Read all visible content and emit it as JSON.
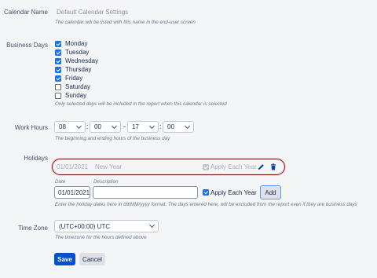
{
  "calendar_name": {
    "label": "Calendar Name",
    "value": "Default Calendar Settings",
    "help": "The calendar will be listed with this name in the end-user screen"
  },
  "business_days": {
    "label": "Business Days",
    "days": [
      {
        "name": "Monday",
        "checked": true
      },
      {
        "name": "Tuesday",
        "checked": true
      },
      {
        "name": "Wednesday",
        "checked": true
      },
      {
        "name": "Thursday",
        "checked": true
      },
      {
        "name": "Friday",
        "checked": true
      },
      {
        "name": "Saturday",
        "checked": false
      },
      {
        "name": "Sunday",
        "checked": false
      }
    ],
    "help": "Only selected days will be included in the report when this calendar is selected"
  },
  "work_hours": {
    "label": "Work Hours",
    "start_hour": "08",
    "start_min": "00",
    "end_hour": "17",
    "end_min": "00",
    "colon": ":",
    "dash": "-",
    "help": "The beginning and ending hours of the business day"
  },
  "holidays": {
    "label": "Holidays",
    "existing": {
      "date": "01/01/2021",
      "description": "New Year",
      "apply_each_year_label": "Apply Each Year",
      "apply_each_year": true
    },
    "new": {
      "date_label": "Date",
      "description_label": "Description",
      "date_value": "01/01/2021",
      "description_value": "",
      "apply_each_year_label": "Apply Each Year",
      "apply_each_year": true,
      "add_label": "Add"
    },
    "help": "Enter the holiday dates here in dd/MM/yyyy format. The days entered here, will be excluded from the report even if they are business days"
  },
  "time_zone": {
    "label": "Time Zone",
    "value": "(UTC+00:00) UTC",
    "help": "The timezone for the hours defined above"
  },
  "actions": {
    "save_label": "Save",
    "cancel_label": "Cancel"
  },
  "colors": {
    "primary": "#0052cc",
    "checkbox": "#1a73e8",
    "highlight_ring": "#7a2a1e",
    "delete_icon": "#0747a6"
  },
  "icons": {
    "edit": "pencil-icon",
    "delete": "trash-icon"
  }
}
